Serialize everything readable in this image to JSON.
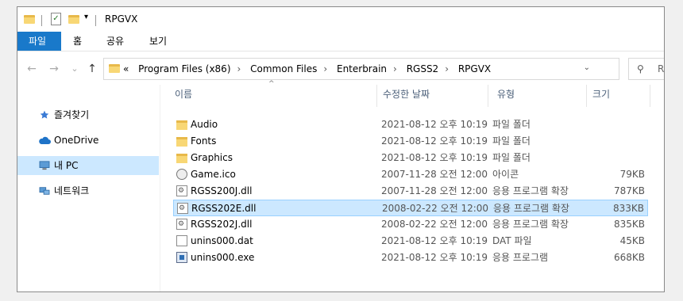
{
  "window": {
    "title": "RPGVX"
  },
  "quick_access": {
    "dropdown_glyph": "▾"
  },
  "ribbon": {
    "tabs": [
      "파일",
      "홈",
      "공유",
      "보기"
    ]
  },
  "nav": {
    "back": "←",
    "forward": "→",
    "recent": "⌄",
    "up": "↑"
  },
  "address": {
    "overflow": "«",
    "crumbs": [
      "Program Files (x86)",
      "Common Files",
      "Enterbrain",
      "RGSS2",
      "RPGVX"
    ],
    "separator": "›",
    "dropdown": "⌄",
    "refresh": "↻"
  },
  "search": {
    "icon": "⚲",
    "placeholder": "R"
  },
  "sidebar": {
    "items": [
      {
        "label": "즐겨찾기",
        "icon": "star-icon"
      },
      {
        "label": "OneDrive",
        "icon": "cloud-icon"
      },
      {
        "label": "내 PC",
        "icon": "computer-icon"
      },
      {
        "label": "네트워크",
        "icon": "network-icon"
      }
    ],
    "selected": 2
  },
  "columns": {
    "name": "이름",
    "date": "수정한 날짜",
    "type": "유형",
    "size": "크기",
    "sort_glyph": "^"
  },
  "files": [
    {
      "name": "Audio",
      "date": "2021-08-12 오후 10:19",
      "type": "파일 폴더",
      "size": "",
      "icon": "folder-icon"
    },
    {
      "name": "Fonts",
      "date": "2021-08-12 오후 10:19",
      "type": "파일 폴더",
      "size": "",
      "icon": "folder-icon"
    },
    {
      "name": "Graphics",
      "date": "2021-08-12 오후 10:19",
      "type": "파일 폴더",
      "size": "",
      "icon": "folder-icon"
    },
    {
      "name": "Game.ico",
      "date": "2007-11-28 오전 12:00",
      "type": "아이콘",
      "size": "79KB",
      "icon": "ico-file-icon"
    },
    {
      "name": "RGSS200J.dll",
      "date": "2007-11-28 오전 12:00",
      "type": "응용 프로그램 확장",
      "size": "787KB",
      "icon": "dll-file-icon"
    },
    {
      "name": "RGSS202E.dll",
      "date": "2008-02-22 오전 12:00",
      "type": "응용 프로그램 확장",
      "size": "833KB",
      "icon": "dll-file-icon"
    },
    {
      "name": "RGSS202J.dll",
      "date": "2008-02-22 오전 12:00",
      "type": "응용 프로그램 확장",
      "size": "835KB",
      "icon": "dll-file-icon"
    },
    {
      "name": "unins000.dat",
      "date": "2021-08-12 오후 10:19",
      "type": "DAT 파일",
      "size": "45KB",
      "icon": "dat-file-icon"
    },
    {
      "name": "unins000.exe",
      "date": "2021-08-12 오후 10:19",
      "type": "응용 프로그램",
      "size": "668KB",
      "icon": "exe-file-icon"
    }
  ],
  "selected_file": 5
}
